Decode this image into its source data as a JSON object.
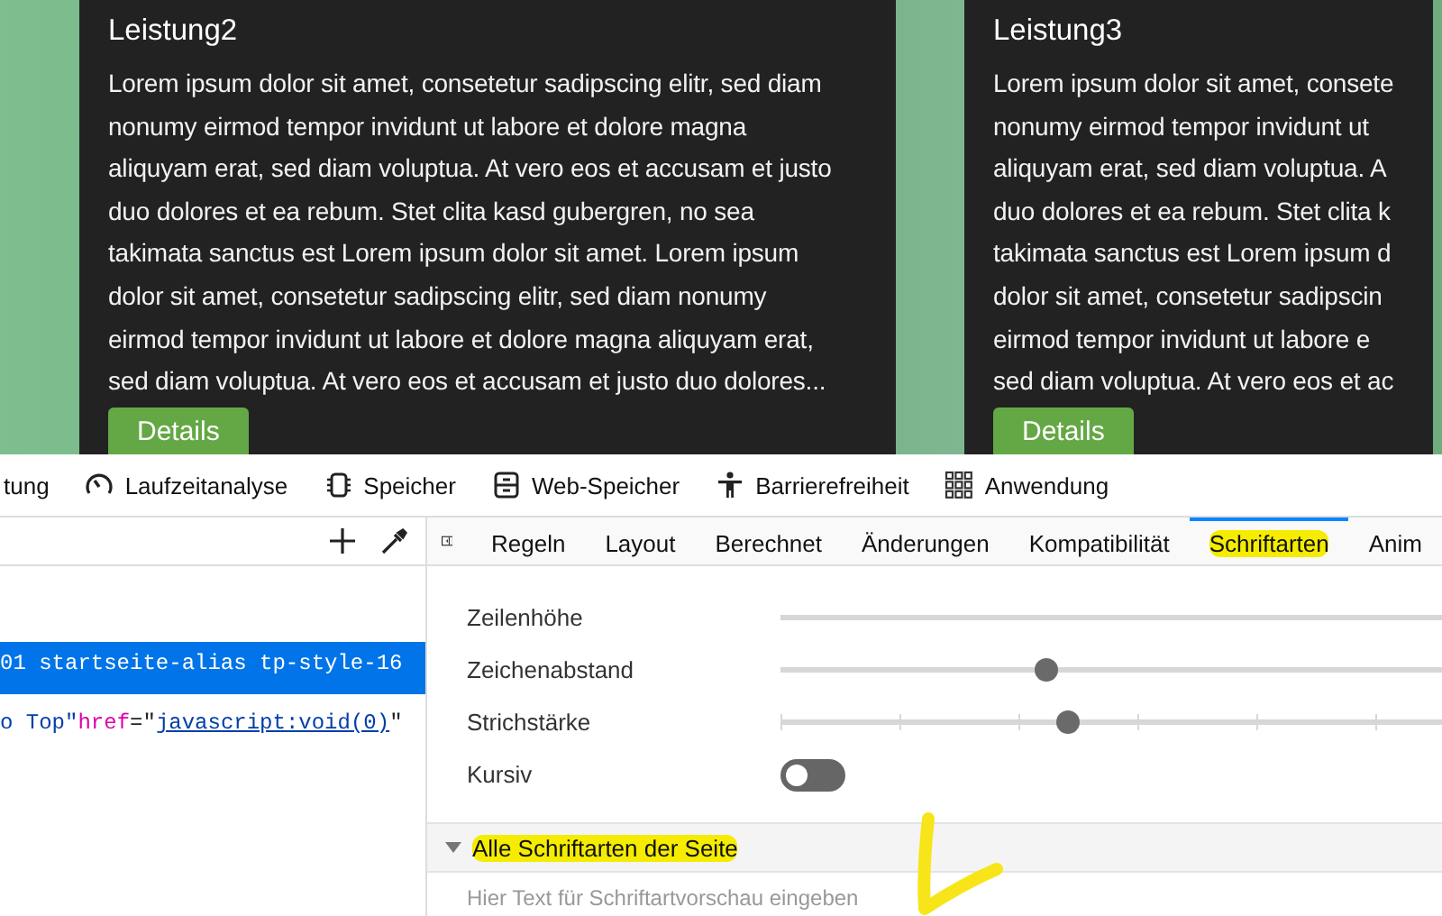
{
  "page": {
    "cards": [
      {
        "title": "Leistung2",
        "text": "Lorem ipsum dolor sit amet, consetetur sadipscing elitr, sed diam\nnonumy eirmod tempor invidunt ut labore et dolore magna\naliquyam erat, sed diam voluptua. At vero eos et accusam et justo\nduo dolores et ea rebum. Stet clita kasd gubergren, no sea\ntakimata sanctus est Lorem ipsum dolor sit amet. Lorem ipsum\ndolor sit amet, consetetur sadipscing elitr, sed diam nonumy\neirmod tempor invidunt ut labore et dolore magna aliquyam erat,\nsed diam voluptua. At vero eos et accusam et justo duo dolores...",
        "button": "Details"
      },
      {
        "title": "Leistung3",
        "text": "Lorem ipsum dolor sit amet, consete\nnonumy eirmod tempor invidunt ut\naliquyam erat, sed diam voluptua. A\nduo dolores et ea rebum. Stet clita k\ntakimata sanctus est Lorem ipsum d\ndolor sit amet, consetetur sadipscin\neirmod tempor invidunt ut labore e\nsed diam voluptua. At vero eos et ac",
        "button": "Details"
      }
    ]
  },
  "devtools_tabs": [
    {
      "label": "tung"
    },
    {
      "label": "Laufzeitanalyse"
    },
    {
      "label": "Speicher"
    },
    {
      "label": "Web-Speicher"
    },
    {
      "label": "Barrierefreiheit"
    },
    {
      "label": "Anwendung"
    }
  ],
  "markup": {
    "lines": [
      {
        "selected": true,
        "tokens": [
          {
            "kind": "plain",
            "text": "01 startseite-alias tp-style-16"
          }
        ]
      },
      {
        "selected": false,
        "tokens": [
          {
            "kind": "value",
            "text": "o Top\""
          },
          {
            "kind": "attr",
            "text": "href"
          },
          {
            "kind": "plain",
            "text": "=\""
          },
          {
            "kind": "link",
            "text": "javascript:void(0)"
          },
          {
            "kind": "plain",
            "text": "\""
          }
        ]
      }
    ]
  },
  "sidebar_tabs": [
    {
      "label": "Regeln",
      "selected": false,
      "highlighted": false
    },
    {
      "label": "Layout",
      "selected": false,
      "highlighted": false
    },
    {
      "label": "Berechnet",
      "selected": false,
      "highlighted": false
    },
    {
      "label": "Änderungen",
      "selected": false,
      "highlighted": false
    },
    {
      "label": "Kompatibilität",
      "selected": false,
      "highlighted": false
    },
    {
      "label": "Schriftarten",
      "selected": true,
      "highlighted": true
    },
    {
      "label": "Anim",
      "selected": false,
      "highlighted": false
    }
  ],
  "font_settings": [
    {
      "label": "Zeilenhöhe",
      "kind": "track"
    },
    {
      "label": "Zeichenabstand",
      "kind": "slider",
      "level": 0.37
    },
    {
      "label": "Strichstärke",
      "kind": "ticked-slider",
      "level": 0.4
    },
    {
      "label": "Kursiv",
      "kind": "toggle",
      "on": false
    }
  ],
  "all_fonts": {
    "title": "Alle Schriftarten der Seite",
    "expanded": true,
    "highlighted": true,
    "placeholder": "Hier Text für Schriftartvorschau eingeben"
  }
}
